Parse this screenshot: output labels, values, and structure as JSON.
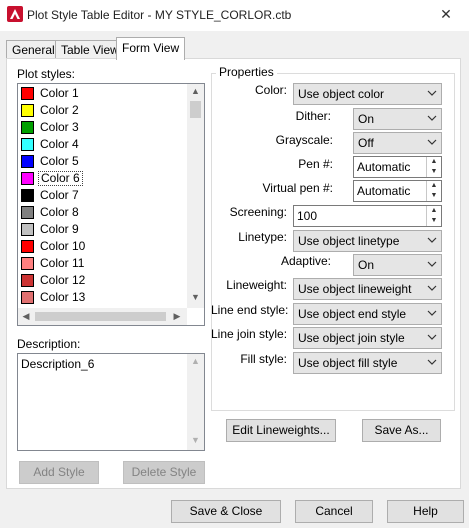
{
  "window": {
    "title": "Plot Style Table Editor - MY STYLE_CORLOR.ctb"
  },
  "tabs": [
    {
      "label": "General",
      "active": false
    },
    {
      "label": "Table View",
      "active": false
    },
    {
      "label": "Form View",
      "active": true
    }
  ],
  "plot_styles": {
    "label": "Plot styles:",
    "items": [
      {
        "label": "Color 1",
        "color": "#ff0000"
      },
      {
        "label": "Color 2",
        "color": "#ffff00"
      },
      {
        "label": "Color 3",
        "color": "#00a000"
      },
      {
        "label": "Color 4",
        "color": "#33ffff"
      },
      {
        "label": "Color 5",
        "color": "#0000ff"
      },
      {
        "label": "Color 6",
        "color": "#ff00ff",
        "selected": true
      },
      {
        "label": "Color 7",
        "color": "#000000"
      },
      {
        "label": "Color 8",
        "color": "#808080"
      },
      {
        "label": "Color 9",
        "color": "#c0c0c0"
      },
      {
        "label": "Color 10",
        "color": "#ff0000"
      },
      {
        "label": "Color 11",
        "color": "#ff8080"
      },
      {
        "label": "Color 12",
        "color": "#cc3333"
      },
      {
        "label": "Color 13",
        "color": "#e07070"
      }
    ]
  },
  "description": {
    "label": "Description:",
    "value": "Description_6"
  },
  "buttons": {
    "add_style": "Add Style",
    "delete_style": "Delete Style",
    "edit_lineweights": "Edit Lineweights...",
    "save_as": "Save As...",
    "save_close": "Save & Close",
    "cancel": "Cancel",
    "help": "Help"
  },
  "properties": {
    "caption": "Properties",
    "color": {
      "label": "Color:",
      "value": "Use object color"
    },
    "dither": {
      "label": "Dither:",
      "value": "On"
    },
    "grayscale": {
      "label": "Grayscale:",
      "value": "Off"
    },
    "pen": {
      "label": "Pen #:",
      "value": "Automatic"
    },
    "virtual_pen": {
      "label": "Virtual pen #:",
      "value": "Automatic"
    },
    "screening": {
      "label": "Screening:",
      "value": "100"
    },
    "linetype": {
      "label": "Linetype:",
      "value": "Use object linetype"
    },
    "adaptive": {
      "label": "Adaptive:",
      "value": "On"
    },
    "lineweight": {
      "label": "Lineweight:",
      "value": "Use object lineweight"
    },
    "line_end_style": {
      "label": "Line end style:",
      "value": "Use object end style"
    },
    "line_join_style": {
      "label": "Line join style:",
      "value": "Use object join style"
    },
    "fill_style": {
      "label": "Fill style:",
      "value": "Use object fill style"
    }
  }
}
